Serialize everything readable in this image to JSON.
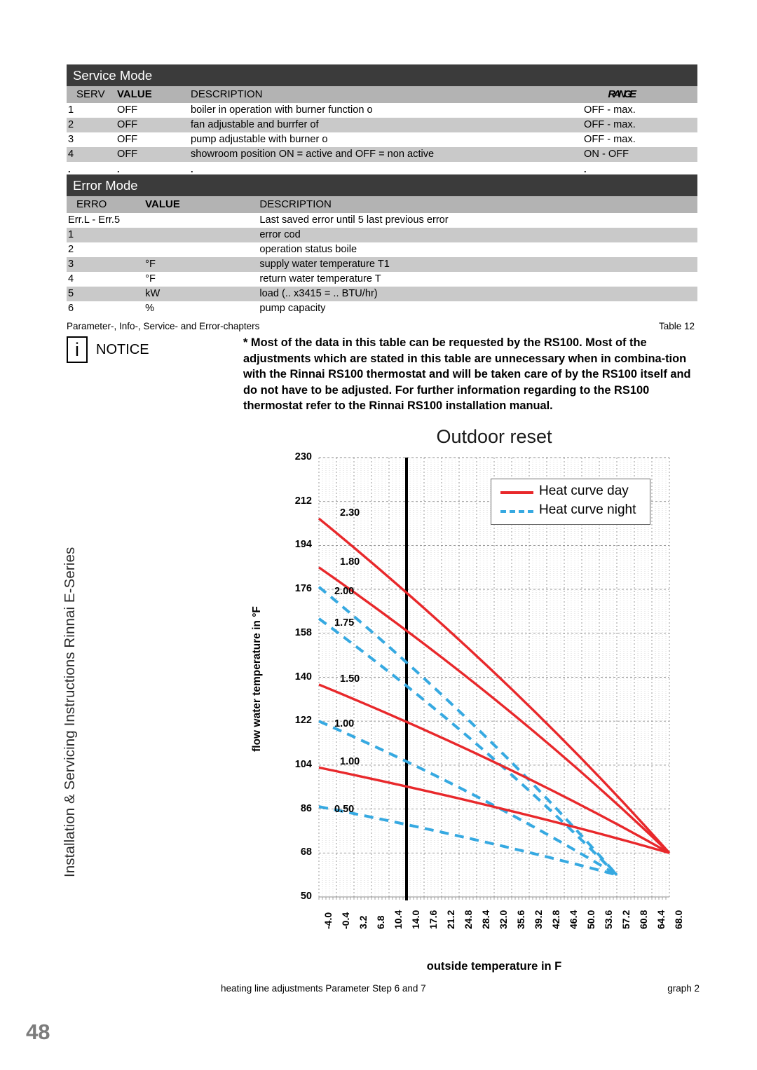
{
  "sidebar": {
    "vertical_text": "Installation & Servicing Instructions Rinnai E-Series",
    "page_number": "48"
  },
  "service_table": {
    "title": "Service Mode",
    "headers": {
      "id": "SERV",
      "value": "VALUE",
      "description": "DESCRIPTION",
      "range": "RANGE"
    },
    "rows": [
      {
        "id": "1",
        "value": "OFF",
        "description": "boiler in operation with burner function o",
        "range": "OFF - max."
      },
      {
        "id": "2",
        "value": "OFF",
        "description": "fan adjustable and burrfer of",
        "range": "OFF - max."
      },
      {
        "id": "3",
        "value": "OFF",
        "description": "pump adjustable with burner o",
        "range": "OFF - max."
      },
      {
        "id": "4",
        "value": "OFF",
        "description": "showroom position ON = active and OFF = non active",
        "range": "ON - OFF"
      }
    ],
    "ellipsis_row": {
      "id": ".",
      "value": ".",
      "description": ".",
      "range": "."
    }
  },
  "error_table": {
    "title": "Error Mode",
    "headers": {
      "id": "ERRO",
      "value": "VALUE",
      "description": "DESCRIPTION"
    },
    "rows": [
      {
        "id": "Err.L - Err.5",
        "value": "",
        "description": "Last saved error until 5 last previous error"
      },
      {
        "id": "1",
        "value": "",
        "description": "error cod"
      },
      {
        "id": "2",
        "value": "",
        "description": "operation status boile"
      },
      {
        "id": "3",
        "value": "°F",
        "description": "supply water temperature T1"
      },
      {
        "id": "4",
        "value": "°F",
        "description": "return water temperature T"
      },
      {
        "id": "5",
        "value": "kW",
        "description": "load  (.. x3415 =  .. BTU/hr)"
      },
      {
        "id": "6",
        "value": "%",
        "description": "pump capacity"
      }
    ],
    "caption_left": "Parameter-, Info-, Service- and Error-chapters",
    "caption_right": "Table 12"
  },
  "notice": {
    "icon": "i",
    "label": "NOTICE",
    "body": "* Most of the data in this table can be requested by the RS100. Most of the adjustments which are stated in this table are unnecessary when in combina-tion with the Rinnai RS100 thermostat and will be taken care of by the RS100 itself and do not have to be adjusted. For further information regarding to the RS100 thermostat refer to the Rinnai RS100 installation manual."
  },
  "graph_caption": {
    "left": "heating line adjustments Parameter Step 6 and 7",
    "right": "graph 2"
  },
  "chart_data": {
    "type": "line",
    "title": "Outdoor reset",
    "xlabel": "outside temperature in  F",
    "ylabel": "flow water temperature in °F",
    "xlim": [
      -4.0,
      68.0
    ],
    "ylim": [
      50,
      230
    ],
    "yticks": [
      50,
      68,
      86,
      104,
      122,
      140,
      158,
      176,
      194,
      212,
      230
    ],
    "xticks": [
      "-4.0",
      "-0.4",
      "3.2",
      "6.8",
      "10.4",
      "14.0",
      "17.6",
      "21.2",
      "24.8",
      "28.4",
      "32.0",
      "35.6",
      "39.2",
      "42.8",
      "46.4",
      "50.0",
      "53.6",
      "57.2",
      "60.8",
      "64.4",
      "68.0"
    ],
    "grid": true,
    "legend_position": "top-right",
    "design_marker_x": 14.0,
    "colors": {
      "day": "#e8282b",
      "night": "#36a9e1",
      "marker": "#000000"
    },
    "legend": [
      {
        "label": "Heat curve day",
        "style": "solid",
        "color": "#e8282b"
      },
      {
        "label": "Heat curve night",
        "style": "dashed",
        "color": "#36a9e1"
      }
    ],
    "series": [
      {
        "name": "2.30",
        "style": "solid",
        "color": "#e8282b",
        "points": [
          [
            -4.0,
            205
          ],
          [
            68.0,
            68
          ]
        ]
      },
      {
        "name": "1.80",
        "style": "solid",
        "color": "#e8282b",
        "points": [
          [
            -4.0,
            185
          ],
          [
            68.0,
            68
          ]
        ]
      },
      {
        "name": "2.00",
        "style": "dashed",
        "color": "#36a9e1",
        "points": [
          [
            -4.0,
            177
          ],
          [
            57.2,
            59
          ]
        ]
      },
      {
        "name": "1.75",
        "style": "dashed",
        "color": "#36a9e1",
        "points": [
          [
            -4.0,
            164
          ],
          [
            57.2,
            59
          ]
        ]
      },
      {
        "name": "1.50",
        "style": "solid",
        "color": "#e8282b",
        "points": [
          [
            -4.0,
            137
          ],
          [
            68.0,
            68
          ]
        ]
      },
      {
        "name": "1.00",
        "style": "dashed",
        "color": "#36a9e1",
        "points": [
          [
            -4.0,
            122
          ],
          [
            57.2,
            59
          ]
        ]
      },
      {
        "name": "1.00",
        "style": "solid",
        "color": "#e8282b",
        "points": [
          [
            -4.0,
            103
          ],
          [
            68.0,
            68
          ]
        ]
      },
      {
        "name": "0.50",
        "style": "dashed",
        "color": "#36a9e1",
        "points": [
          [
            -4.0,
            87
          ],
          [
            57.2,
            59
          ]
        ]
      }
    ]
  }
}
